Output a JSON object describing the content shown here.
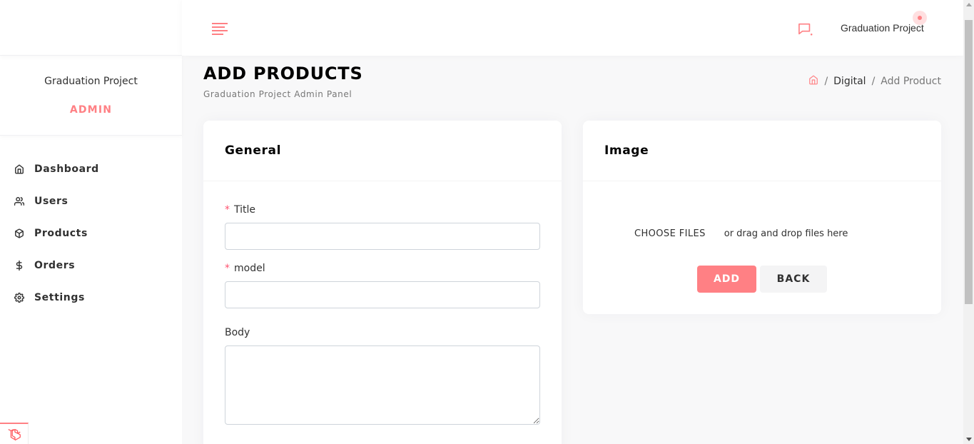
{
  "sidebar": {
    "user_name": "Graduation Project",
    "user_role": "ADMIN",
    "items": [
      {
        "label": "Dashboard",
        "icon": "home-icon"
      },
      {
        "label": "Users",
        "icon": "users-icon"
      },
      {
        "label": "Products",
        "icon": "box-icon"
      },
      {
        "label": "Orders",
        "icon": "dollar-icon"
      },
      {
        "label": "Settings",
        "icon": "gear-icon"
      }
    ]
  },
  "header": {
    "user_name": "Graduation Project"
  },
  "page": {
    "title": "ADD PRODUCTS",
    "subtitle": "Graduation Project Admin Panel",
    "breadcrumb": [
      "Digital",
      "Add Product"
    ]
  },
  "general_card": {
    "title": "General",
    "fields": {
      "title_label": "Title",
      "title_value": "",
      "model_label": "model",
      "model_value": "",
      "body_label": "Body",
      "body_value": ""
    },
    "required_marker": "*"
  },
  "image_card": {
    "title": "Image",
    "choose_files_label": "CHOOSE FILES",
    "drag_text": "or drag and drop files here",
    "add_label": "ADD",
    "back_label": "BACK"
  },
  "colors": {
    "accent": "#ff8084",
    "background": "#f8f8f9",
    "card": "#ffffff",
    "required": "#ff5370"
  }
}
